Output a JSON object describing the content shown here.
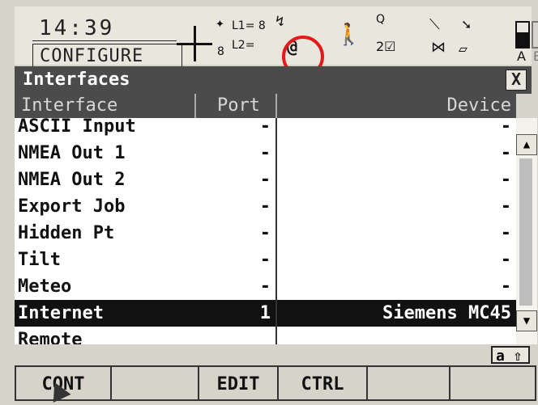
{
  "status": {
    "time": "14:39",
    "mode": "CONFIGURE",
    "sat_l1": "L1= 8",
    "sat_l2": "L2=",
    "sat_count": "8",
    "at_symbol": "@",
    "code_label": "Q",
    "code_count": "2☑",
    "battery_labels": [
      "A",
      "B"
    ]
  },
  "window": {
    "title": "Interfaces",
    "close": "X"
  },
  "table": {
    "headers": [
      "Interface",
      "Port",
      "Device"
    ],
    "rows": [
      {
        "interface": "ASCII Input",
        "port": "-",
        "device": "-"
      },
      {
        "interface": "NMEA Out 1",
        "port": "-",
        "device": "-"
      },
      {
        "interface": "NMEA Out 2",
        "port": "-",
        "device": "-"
      },
      {
        "interface": "Export Job",
        "port": "-",
        "device": "-"
      },
      {
        "interface": "Hidden Pt",
        "port": "-",
        "device": "-"
      },
      {
        "interface": "Tilt",
        "port": "-",
        "device": "-"
      },
      {
        "interface": "Meteo",
        "port": "-",
        "device": "-"
      },
      {
        "interface": "Internet",
        "port": "1",
        "device": "Siemens MC45",
        "selected": true
      },
      {
        "interface": "Remote",
        "port": "",
        "device": ""
      }
    ]
  },
  "input_mode": "a ⇧",
  "softkeys": [
    "CONT",
    "",
    "EDIT",
    "CTRL",
    "",
    ""
  ]
}
